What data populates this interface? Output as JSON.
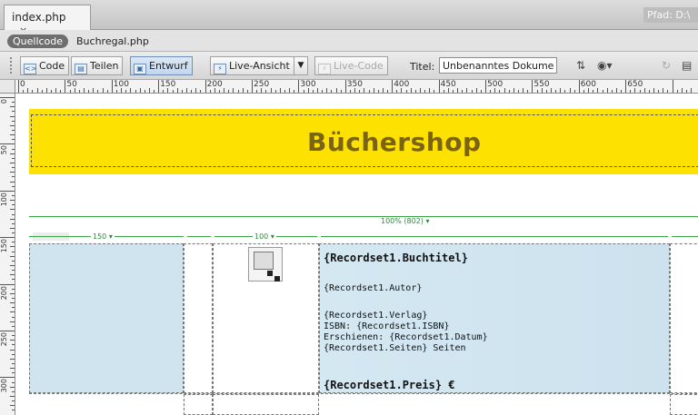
{
  "tab": {
    "title": "index.php",
    "close": "×"
  },
  "path": "Pfad: D:\\",
  "related": {
    "source_label": "Quellcode",
    "file": "Buchregal.php"
  },
  "toolbar": {
    "code": "Code",
    "split": "Teilen",
    "design": "Entwurf",
    "live_view": "Live-Ansicht",
    "live_code": "Live-Code",
    "title_label": "Titel:",
    "title_value": "Unbenanntes Dokument"
  },
  "ruler": {
    "h_numbers": [
      "0",
      "50",
      "100",
      "150",
      "200",
      "250",
      "300",
      "350",
      "400",
      "450",
      "500",
      "550",
      "600",
      "650"
    ],
    "v_numbers": [
      "0",
      "50",
      "100",
      "150",
      "200",
      "250",
      "300"
    ]
  },
  "page": {
    "banner_title": "Büchershop",
    "table_width_label": "100% (802) ▾",
    "col_width_1": "150 ▾",
    "col_width_2": "100 ▾",
    "book_title": "{Recordset1.Buchtitel}",
    "author": "{Recordset1.Autor}",
    "publisher": "{Recordset1.Verlag}",
    "isbn": "ISBN: {Recordset1.ISBN}",
    "published": "Erschienen: {Recordset1.Datum}",
    "pages": "{Recordset1.Seiten} Seiten",
    "price": "{Recordset1.Preis} €"
  },
  "colors": {
    "banner": "#fde100",
    "banner_text": "#7a6414",
    "cell": "#d0e4ef",
    "table_guide": "#3aa64a"
  }
}
